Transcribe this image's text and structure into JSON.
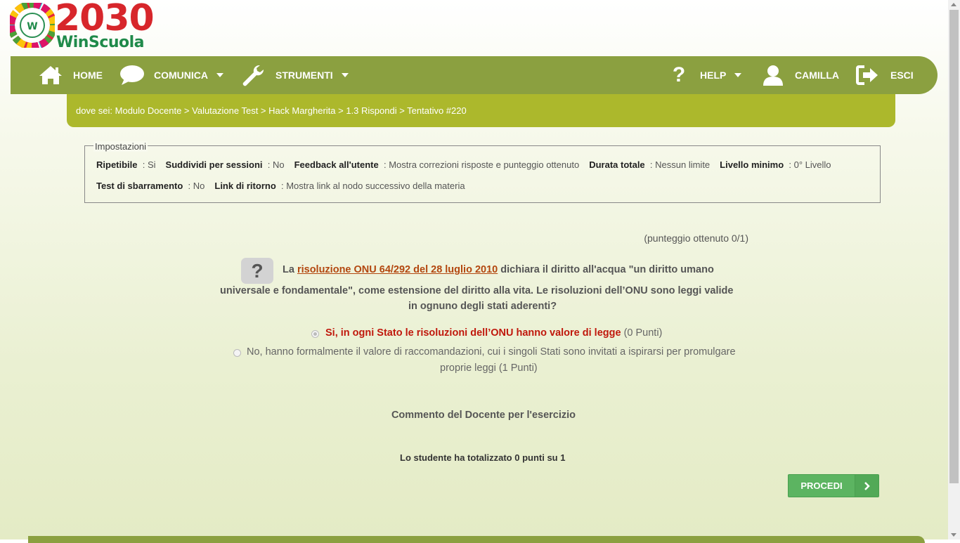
{
  "logo": {
    "number": "2030",
    "brand": "WinScuola",
    "wheel_letter": "W"
  },
  "nav": {
    "home": "HOME",
    "comunica": "COMUNICA",
    "strumenti": "STRUMENTI",
    "help": "HELP",
    "user": "CAMILLA",
    "esci": "ESCI"
  },
  "breadcrumb": "dove sei: Modulo Docente > Valutazione Test > Hack Margherita > 1.3 Rispondi > Tentativo #220",
  "settings": {
    "legend": "Impostazioni",
    "items": [
      {
        "label": "Ripetibile",
        "value": ": Si"
      },
      {
        "label": "Suddividi per sessioni",
        "value": ": No"
      },
      {
        "label": "Feedback all'utente",
        "value": ": Mostra correzioni risposte e punteggio ottenuto"
      },
      {
        "label": "Durata totale",
        "value": ": Nessun limite"
      },
      {
        "label": "Livello minimo",
        "value": ": 0° Livello"
      },
      {
        "label": "Test di sbarramento",
        "value": ": No"
      },
      {
        "label": "Link di ritorno",
        "value": ": Mostra link al nodo successivo della materia"
      }
    ]
  },
  "score": "(punteggio ottenuto 0/1)",
  "question": {
    "icon": "?",
    "prefix": "La",
    "link": "risoluzione ONU 64/292 del 28 luglio 2010",
    "line1_rest": "dichiara il diritto all'acqua \"un diritto umano",
    "line2": "universale e fondamentale\", come estensione del diritto alla vita. Le risoluzioni dell’ONU sono leggi valide",
    "line3": "in ognuno degli stati aderenti?"
  },
  "options": [
    {
      "text": "Si, in ogni Stato le risoluzioni dell’ONU hanno valore di legge",
      "points": "(0 Punti)",
      "selected": true
    },
    {
      "text_line1": "No, hanno formalmente il valore di raccomandazioni, cui i singoli Stati sono invitati a ispirarsi per promulgare",
      "text_line2": "proprie leggi (1 Punti)",
      "selected": false
    }
  ],
  "comment_title": "Commento del Docente per l'esercizio",
  "total": "Lo studente ha totalizzato 0 punti su 1",
  "proceed_button": "PROCEDI",
  "colors": {
    "nav": "#8ba040",
    "breadcrumb": "#acb82c",
    "link": "#b3470f",
    "wrong_answer": "#c0180c",
    "button": "#5cb461"
  }
}
